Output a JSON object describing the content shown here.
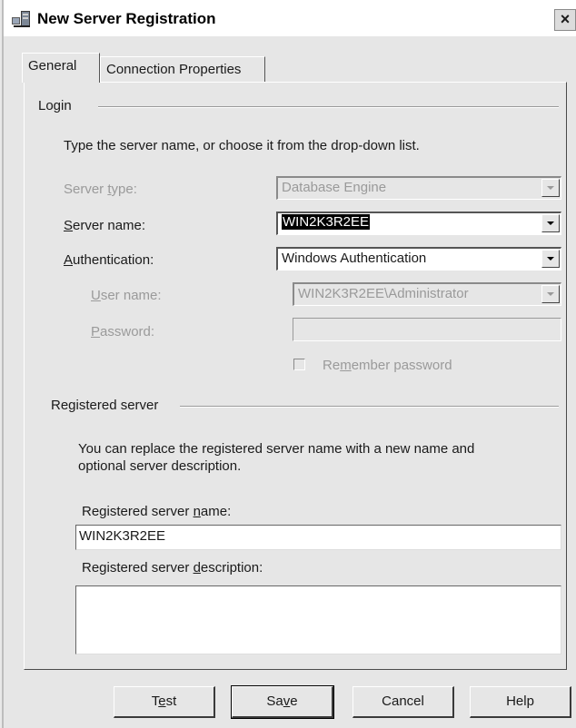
{
  "window": {
    "title": "New Server Registration",
    "close_glyph": "×"
  },
  "tabs": [
    {
      "label": "General",
      "active": true
    },
    {
      "label": "Connection Properties",
      "active": false
    }
  ],
  "login": {
    "group_label": "Login",
    "instructions": "Type the server name, or choose it from the drop-down list.",
    "server_type": {
      "label_pre": "Server ",
      "label_key": "t",
      "label_post": "ype:",
      "value": "Database Engine"
    },
    "server_name": {
      "label_key": "S",
      "label_post": "erver name:",
      "value": "WIN2K3R2EE"
    },
    "authentication": {
      "label_key": "A",
      "label_post": "uthentication:",
      "value": "Windows Authentication"
    },
    "user_name": {
      "label_key": "U",
      "label_post": "ser name:",
      "value": "WIN2K3R2EE\\Administrator"
    },
    "password": {
      "label_key": "P",
      "label_post": "assword:",
      "value": ""
    },
    "remember": {
      "label_pre": "Re",
      "label_key": "m",
      "label_post": "ember password",
      "checked": false
    }
  },
  "registered": {
    "group_label": "Registered server",
    "description_line1": "You can replace the registered server name with a new name and",
    "description_line2": "optional server description.",
    "name_label_pre": "Registered server ",
    "name_label_key": "n",
    "name_label_post": "ame:",
    "name_value": "WIN2K3R2EE",
    "desc_label_pre": "Registered server ",
    "desc_label_key": "d",
    "desc_label_post": "escription:",
    "desc_value": ""
  },
  "buttons": {
    "test": {
      "pre": "T",
      "key": "e",
      "post": "st"
    },
    "save": {
      "pre": "Sa",
      "key": "v",
      "post": "e"
    },
    "cancel": "Cancel",
    "help": "Help"
  }
}
